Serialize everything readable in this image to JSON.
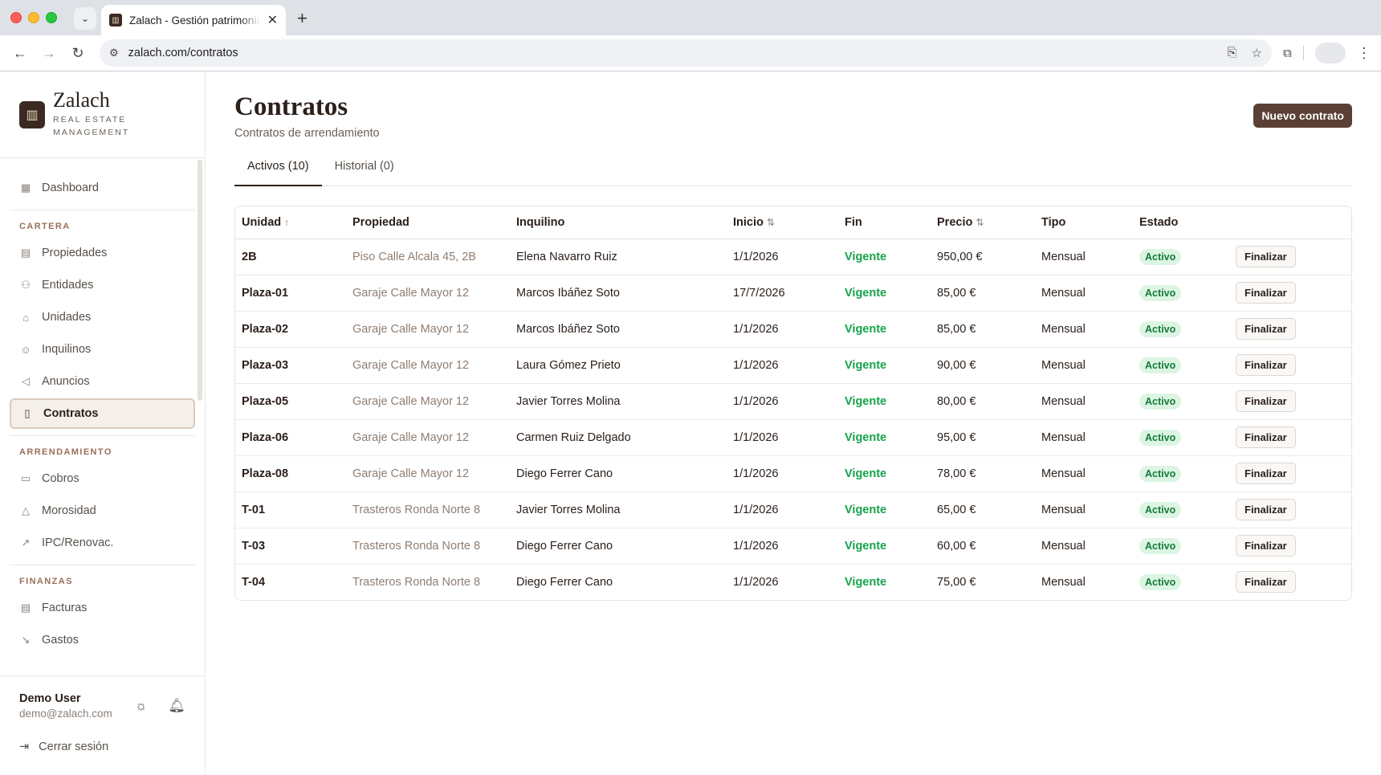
{
  "browser": {
    "tab_title": "Zalach - Gestión patrimonial",
    "url": "zalach.com/contratos"
  },
  "brand": {
    "name": "Zalach",
    "sub1": "REAL ESTATE",
    "sub2": "MANAGEMENT"
  },
  "sidebar": {
    "dashboard": "Dashboard",
    "sections": [
      {
        "title": "CARTERA",
        "items": [
          "Propiedades",
          "Entidades",
          "Unidades",
          "Inquilinos",
          "Anuncios",
          "Contratos"
        ]
      },
      {
        "title": "ARRENDAMIENTO",
        "items": [
          "Cobros",
          "Morosidad",
          "IPC/Renovac."
        ]
      },
      {
        "title": "FINANZAS",
        "items": [
          "Facturas",
          "Gastos"
        ]
      }
    ],
    "active": "Contratos"
  },
  "user": {
    "name": "Demo User",
    "email": "demo@zalach.com",
    "logout": "Cerrar sesión"
  },
  "page": {
    "title": "Contratos",
    "subtitle": "Contratos de arrendamiento",
    "new_button": "Nuevo contrato",
    "tabs": [
      "Activos (10)",
      "Historial (0)"
    ]
  },
  "table": {
    "headers": [
      "Unidad",
      "Propiedad",
      "Inquilino",
      "Inicio",
      "Fin",
      "Precio",
      "Tipo",
      "Estado"
    ],
    "action_label": "Finalizar",
    "rows": [
      {
        "unidad": "2B",
        "propiedad": "Piso Calle Alcala 45, 2B",
        "inquilino": "Elena Navarro Ruiz",
        "inicio": "1/1/2026",
        "fin": "Vigente",
        "precio": "950,00 €",
        "tipo": "Mensual",
        "estado": "Activo"
      },
      {
        "unidad": "Plaza-01",
        "propiedad": "Garaje Calle Mayor 12",
        "inquilino": "Marcos Ibáñez Soto",
        "inicio": "17/7/2026",
        "fin": "Vigente",
        "precio": "85,00 €",
        "tipo": "Mensual",
        "estado": "Activo"
      },
      {
        "unidad": "Plaza-02",
        "propiedad": "Garaje Calle Mayor 12",
        "inquilino": "Marcos Ibáñez Soto",
        "inicio": "1/1/2026",
        "fin": "Vigente",
        "precio": "85,00 €",
        "tipo": "Mensual",
        "estado": "Activo"
      },
      {
        "unidad": "Plaza-03",
        "propiedad": "Garaje Calle Mayor 12",
        "inquilino": "Laura Gómez Prieto",
        "inicio": "1/1/2026",
        "fin": "Vigente",
        "precio": "90,00 €",
        "tipo": "Mensual",
        "estado": "Activo"
      },
      {
        "unidad": "Plaza-05",
        "propiedad": "Garaje Calle Mayor 12",
        "inquilino": "Javier Torres Molina",
        "inicio": "1/1/2026",
        "fin": "Vigente",
        "precio": "80,00 €",
        "tipo": "Mensual",
        "estado": "Activo"
      },
      {
        "unidad": "Plaza-06",
        "propiedad": "Garaje Calle Mayor 12",
        "inquilino": "Carmen Ruiz Delgado",
        "inicio": "1/1/2026",
        "fin": "Vigente",
        "precio": "95,00 €",
        "tipo": "Mensual",
        "estado": "Activo"
      },
      {
        "unidad": "Plaza-08",
        "propiedad": "Garaje Calle Mayor 12",
        "inquilino": "Diego Ferrer Cano",
        "inicio": "1/1/2026",
        "fin": "Vigente",
        "precio": "78,00 €",
        "tipo": "Mensual",
        "estado": "Activo"
      },
      {
        "unidad": "T-01",
        "propiedad": "Trasteros Ronda Norte 8",
        "inquilino": "Javier Torres Molina",
        "inicio": "1/1/2026",
        "fin": "Vigente",
        "precio": "65,00 €",
        "tipo": "Mensual",
        "estado": "Activo"
      },
      {
        "unidad": "T-03",
        "propiedad": "Trasteros Ronda Norte 8",
        "inquilino": "Diego Ferrer Cano",
        "inicio": "1/1/2026",
        "fin": "Vigente",
        "precio": "60,00 €",
        "tipo": "Mensual",
        "estado": "Activo"
      },
      {
        "unidad": "T-04",
        "propiedad": "Trasteros Ronda Norte 8",
        "inquilino": "Diego Ferrer Cano",
        "inicio": "1/1/2026",
        "fin": "Vigente",
        "precio": "75,00 €",
        "tipo": "Mensual",
        "estado": "Activo"
      }
    ]
  },
  "colors": {
    "accent": "#5a4035",
    "status_green": "#16a34a",
    "badge_bg": "#dcf5e3"
  }
}
